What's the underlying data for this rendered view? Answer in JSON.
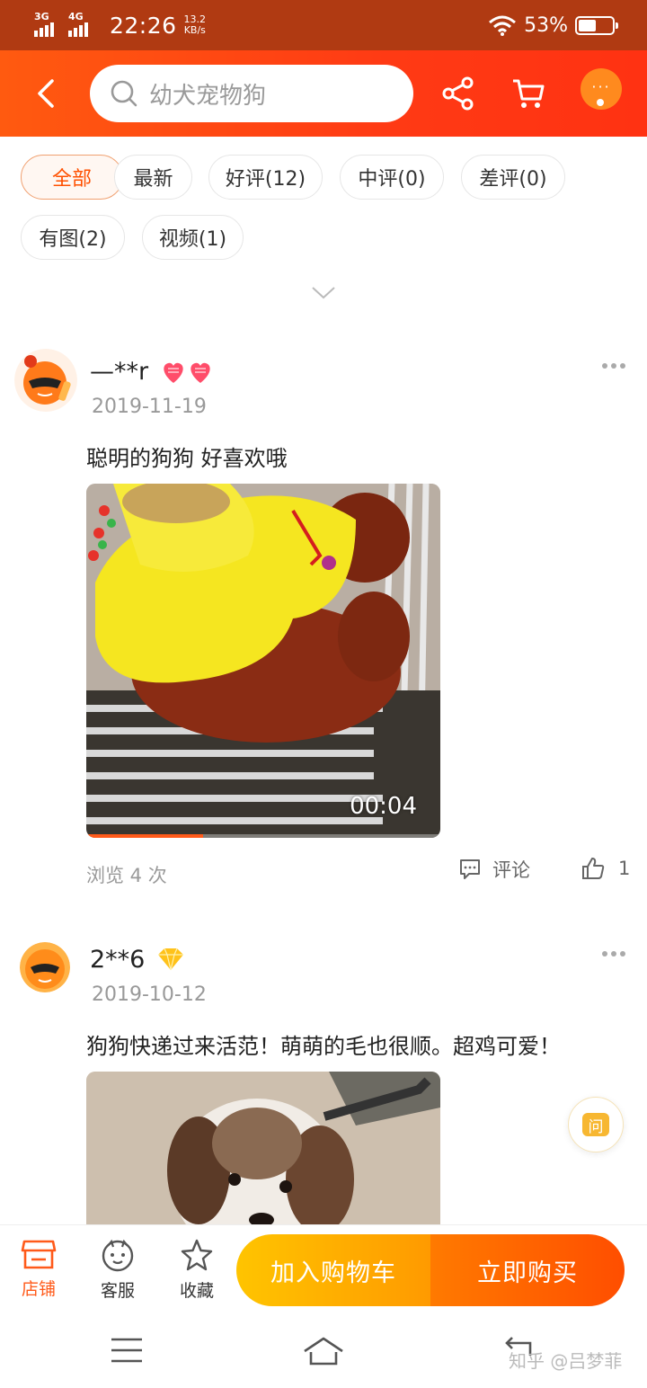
{
  "status_bar": {
    "network_1": "3G",
    "network_2": "4G",
    "time": "22:26",
    "speed_value": "13.2",
    "speed_unit": "KB/s",
    "battery": "53%",
    "battery_level": 0.53
  },
  "header": {
    "search_placeholder": "幼犬宠物狗",
    "more_label": "···"
  },
  "filters": [
    {
      "label": "全部",
      "active": true
    },
    {
      "label": "最新",
      "active": false
    },
    {
      "label": "好评(12)",
      "active": false
    },
    {
      "label": "中评(0)",
      "active": false
    },
    {
      "label": "差评(0)",
      "active": false
    },
    {
      "label": "有图(2)",
      "active": false
    },
    {
      "label": "视频(1)",
      "active": false
    }
  ],
  "reviews": [
    {
      "username": "—**r",
      "badge": "hearts",
      "date": "2019-11-19",
      "text": "聪明的狗狗  好喜欢哦",
      "video_time": "00:04",
      "video_progress": 0.33,
      "views": "浏览 4 次",
      "comment_label": "评论",
      "likes": "1"
    },
    {
      "username": "2**6",
      "badge": "diamond",
      "date": "2019-10-12",
      "text": "狗狗快递过来活范！萌萌的毛也很顺。超鸡可爱！"
    }
  ],
  "ask_label": "问",
  "bottom_bar": {
    "store": "店铺",
    "service": "客服",
    "favorite": "收藏",
    "add_cart": "加入购物车",
    "buy_now": "立即购买"
  },
  "watermark": "知乎 @吕梦菲",
  "colors": {
    "status_bar": "#b03a12",
    "header": "#ff4a12",
    "accent": "#ff5000",
    "cart_btn": "#ffb000",
    "buy_btn": "#ff5a00"
  }
}
